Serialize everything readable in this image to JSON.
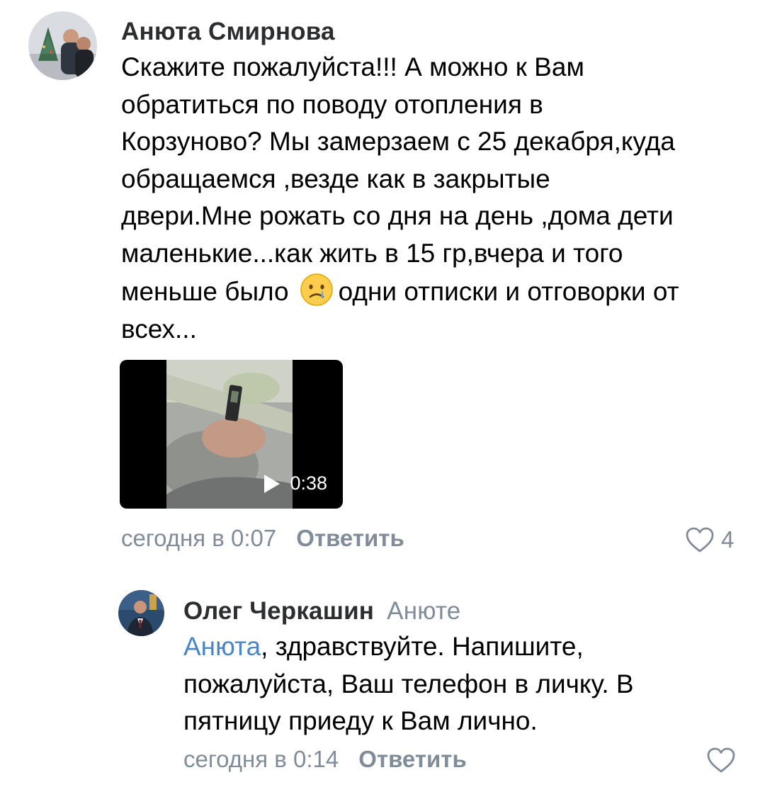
{
  "comments": [
    {
      "author": "Анюта Смирнова",
      "lines_before_emoji": [
        "Скажите пожалуйста!!! А можно к Вам",
        "обратиться по поводу отопления в",
        "Корзуново? Мы замерзаем с 25 декабря,куда",
        "обращаемся ,везде как в закрытые",
        "двери.Мне рожать со дня на день ,дома дети",
        "маленькие...как жить в 15 гр,вчера и того"
      ],
      "emoji_line_start": "меньше было",
      "emoji_icon": "crying-face-emoji",
      "emoji_line_end": "одни отписки и отговорки от",
      "last_line": "всех...",
      "video": {
        "duration": "0:38",
        "icon": "play-icon"
      },
      "time": "сегодня в 0:07",
      "reply_label": "Ответить",
      "likes": "4",
      "like_icon": "heart-outline-icon"
    },
    {
      "author": "Олег Черкашин",
      "reply_to": "Анюте",
      "mention": "Анюта",
      "line1_rest": ", здравствуйте. Напишите,",
      "line2": "пожалуйста, Ваш телефон в личку. В",
      "line3": "пятницу приеду к Вам лично.",
      "time": "сегодня в 0:14",
      "reply_label": "Ответить",
      "like_icon": "heart-outline-icon"
    }
  ],
  "colors": {
    "meta_gray": "#818c99",
    "mention_blue": "#4a86c5",
    "author_dark": "#2c2d2e"
  }
}
